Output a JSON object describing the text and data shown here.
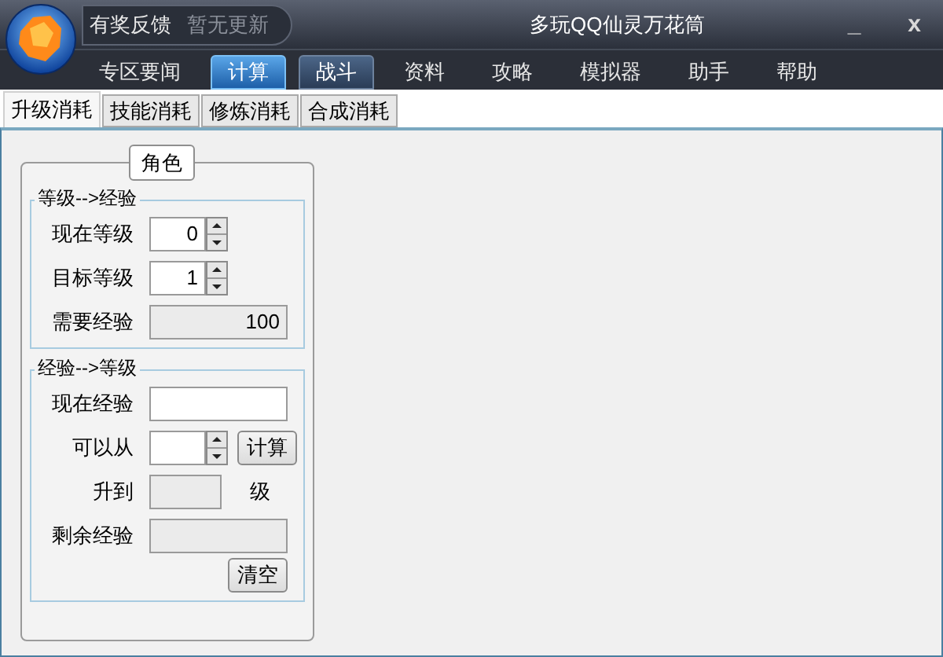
{
  "window": {
    "title": "多玩QQ仙灵万花筒",
    "links": [
      "有奖反馈",
      "暂无更新"
    ],
    "controls": [
      "_",
      "x"
    ]
  },
  "nav": [
    {
      "label": "专区要闻",
      "selected": false,
      "hover": false
    },
    {
      "label": "计算",
      "selected": true,
      "hover": false
    },
    {
      "label": "战斗",
      "selected": false,
      "hover": true
    },
    {
      "label": "资料",
      "selected": false,
      "hover": false
    },
    {
      "label": "攻略",
      "selected": false,
      "hover": false
    },
    {
      "label": "模拟器",
      "selected": false,
      "hover": false
    },
    {
      "label": "助手",
      "selected": false,
      "hover": false
    },
    {
      "label": "帮助",
      "selected": false,
      "hover": false
    }
  ],
  "subtabs": [
    {
      "label": "升级消耗",
      "selected": true
    },
    {
      "label": "技能消耗",
      "selected": false
    },
    {
      "label": "修炼消耗",
      "selected": false
    },
    {
      "label": "合成消耗",
      "selected": false
    }
  ],
  "panel": {
    "title": "角色",
    "groups": [
      {
        "title": "等级-->经验",
        "rows": [
          {
            "kind": "spinner",
            "label": "现在等级",
            "value": "0"
          },
          {
            "kind": "spinner",
            "label": "目标等级",
            "value": "1"
          },
          {
            "kind": "readonly",
            "label": "需要经验",
            "value": "100"
          }
        ]
      },
      {
        "title": "经验-->等级",
        "rows": [
          {
            "kind": "input",
            "label": "现在经验"
          },
          {
            "kind": "spinner",
            "label": "可以从",
            "button": "计算"
          },
          {
            "kind": "readonly_small",
            "label": "升到",
            "suffix": "级"
          },
          {
            "kind": "readonly",
            "label": "剩余经验"
          },
          {
            "kind": "button",
            "button": "清空"
          }
        ]
      }
    ]
  }
}
